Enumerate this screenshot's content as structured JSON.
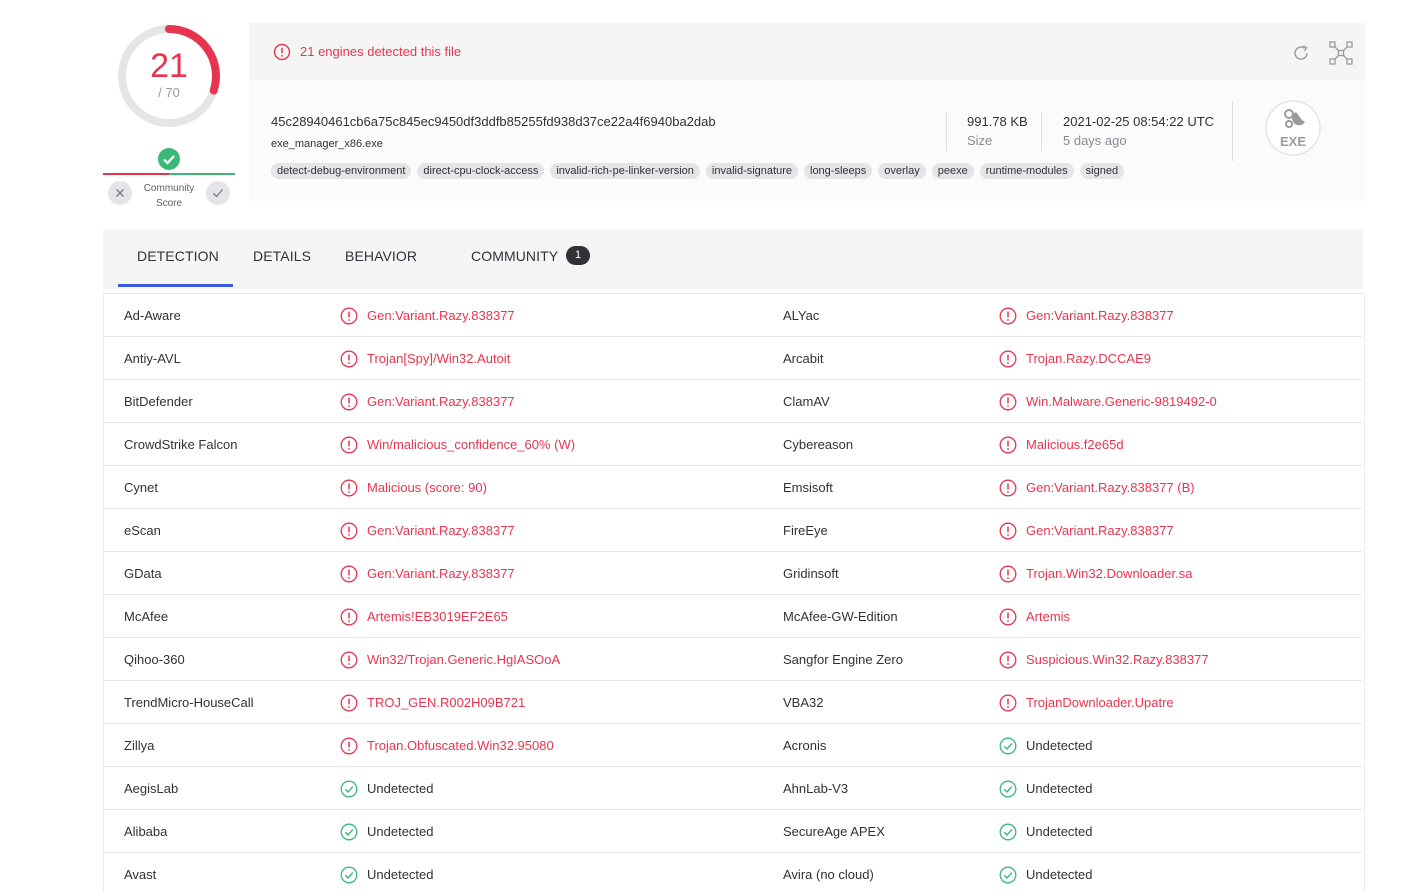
{
  "score": {
    "detected": "21",
    "total": "/ 70",
    "label": "Community\nScore"
  },
  "community": {
    "label_line1": "Community",
    "label_line2": "Score"
  },
  "alert": {
    "text": "21 engines detected this file"
  },
  "file": {
    "hash": "45c28940461cb6a75c845ec9450df3ddfb85255fd938d37ce22a4f6940ba2dab",
    "name": "exe_manager_x86.exe",
    "size_value": "991.78 KB",
    "size_label": "Size",
    "date_value": "2021-02-25 08:54:22 UTC",
    "date_label": "5 days ago",
    "type_label": "EXE",
    "tags": [
      "detect-debug-environment",
      "direct-cpu-clock-access",
      "invalid-rich-pe-linker-version",
      "invalid-signature",
      "long-sleeps",
      "overlay",
      "peexe",
      "runtime-modules",
      "signed"
    ]
  },
  "tabs": {
    "detection": "DETECTION",
    "details": "DETAILS",
    "behavior": "BEHAVIOR",
    "community": "COMMUNITY",
    "community_count": "1"
  },
  "colors": {
    "malicious": "#e8354f",
    "clean": "#3cb878",
    "accent": "#3b5bdb"
  },
  "rows": [
    {
      "l_engine": "Ad-Aware",
      "l_result": "Gen:Variant.Razy.838377",
      "l_mal": true,
      "r_engine": "ALYac",
      "r_result": "Gen:Variant.Razy.838377",
      "r_mal": true
    },
    {
      "l_engine": "Antiy-AVL",
      "l_result": "Trojan[Spy]/Win32.Autoit",
      "l_mal": true,
      "r_engine": "Arcabit",
      "r_result": "Trojan.Razy.DCCAE9",
      "r_mal": true
    },
    {
      "l_engine": "BitDefender",
      "l_result": "Gen:Variant.Razy.838377",
      "l_mal": true,
      "r_engine": "ClamAV",
      "r_result": "Win.Malware.Generic-9819492-0",
      "r_mal": true
    },
    {
      "l_engine": "CrowdStrike Falcon",
      "l_result": "Win/malicious_confidence_60% (W)",
      "l_mal": true,
      "r_engine": "Cybereason",
      "r_result": "Malicious.f2e65d",
      "r_mal": true
    },
    {
      "l_engine": "Cynet",
      "l_result": "Malicious (score: 90)",
      "l_mal": true,
      "r_engine": "Emsisoft",
      "r_result": "Gen:Variant.Razy.838377 (B)",
      "r_mal": true
    },
    {
      "l_engine": "eScan",
      "l_result": "Gen:Variant.Razy.838377",
      "l_mal": true,
      "r_engine": "FireEye",
      "r_result": "Gen:Variant.Razy.838377",
      "r_mal": true
    },
    {
      "l_engine": "GData",
      "l_result": "Gen:Variant.Razy.838377",
      "l_mal": true,
      "r_engine": "Gridinsoft",
      "r_result": "Trojan.Win32.Downloader.sa",
      "r_mal": true
    },
    {
      "l_engine": "McAfee",
      "l_result": "Artemis!EB3019EF2E65",
      "l_mal": true,
      "r_engine": "McAfee-GW-Edition",
      "r_result": "Artemis",
      "r_mal": true
    },
    {
      "l_engine": "Qihoo-360",
      "l_result": "Win32/Trojan.Generic.HgIASOoA",
      "l_mal": true,
      "r_engine": "Sangfor Engine Zero",
      "r_result": "Suspicious.Win32.Razy.838377",
      "r_mal": true
    },
    {
      "l_engine": "TrendMicro-HouseCall",
      "l_result": "TROJ_GEN.R002H09B721",
      "l_mal": true,
      "r_engine": "VBA32",
      "r_result": "TrojanDownloader.Upatre",
      "r_mal": true
    },
    {
      "l_engine": "Zillya",
      "l_result": "Trojan.Obfuscated.Win32.95080",
      "l_mal": true,
      "r_engine": "Acronis",
      "r_result": "Undetected",
      "r_mal": false
    },
    {
      "l_engine": "AegisLab",
      "l_result": "Undetected",
      "l_mal": false,
      "r_engine": "AhnLab-V3",
      "r_result": "Undetected",
      "r_mal": false
    },
    {
      "l_engine": "Alibaba",
      "l_result": "Undetected",
      "l_mal": false,
      "r_engine": "SecureAge APEX",
      "r_result": "Undetected",
      "r_mal": false
    },
    {
      "l_engine": "Avast",
      "l_result": "Undetected",
      "l_mal": false,
      "r_engine": "Avira (no cloud)",
      "r_result": "Undetected",
      "r_mal": false
    }
  ]
}
